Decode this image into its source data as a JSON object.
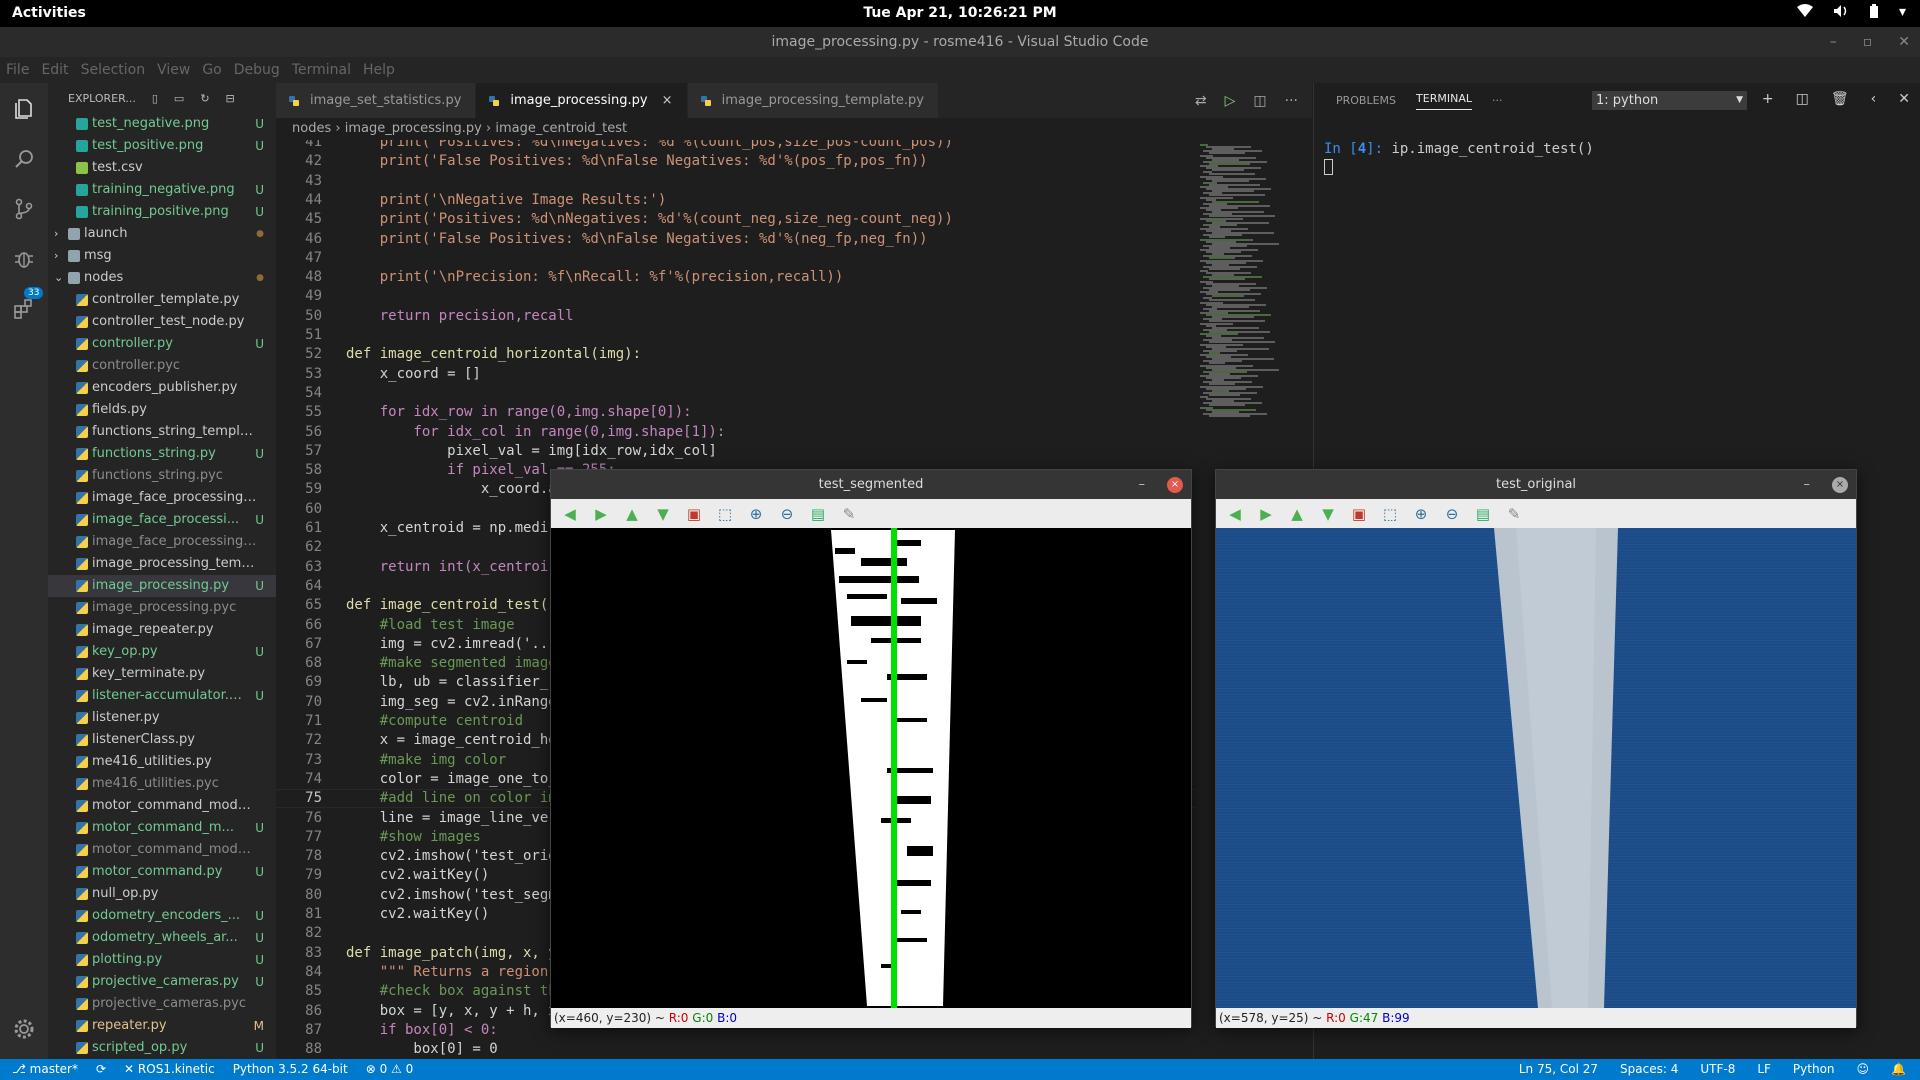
{
  "topbar": {
    "activities": "Activities",
    "clock": "Tue Apr 21, 10:26:21 PM"
  },
  "window": {
    "title": "image_processing.py - rosme416 - Visual Studio Code"
  },
  "menu": [
    "File",
    "Edit",
    "Selection",
    "View",
    "Go",
    "Debug",
    "Terminal",
    "Help"
  ],
  "activity": {
    "scm_badge": "33"
  },
  "explorer": {
    "title": "EXPLORER...",
    "files": [
      {
        "name": "test_negative.png",
        "status": "U",
        "color": "#73c991",
        "indent": 1,
        "icon": "image"
      },
      {
        "name": "test_positive.png",
        "status": "U",
        "color": "#73c991",
        "indent": 1,
        "icon": "image"
      },
      {
        "name": "test.csv",
        "status": "",
        "color": "#cccccc",
        "indent": 1,
        "icon": "csv"
      },
      {
        "name": "training_negative.png",
        "status": "U",
        "color": "#73c991",
        "indent": 1,
        "icon": "image"
      },
      {
        "name": "training_positive.png",
        "status": "U",
        "color": "#73c991",
        "indent": 1,
        "icon": "image"
      },
      {
        "name": "launch",
        "status": "●",
        "color": "#cccccc",
        "indent": 0,
        "icon": "folder",
        "arrow": ">"
      },
      {
        "name": "msg",
        "status": "",
        "color": "#cccccc",
        "indent": 0,
        "icon": "folder",
        "arrow": ">"
      },
      {
        "name": "nodes",
        "status": "●",
        "color": "#cccccc",
        "indent": 0,
        "icon": "folder",
        "arrow": "v"
      },
      {
        "name": "controller_template.py",
        "status": "",
        "color": "#cccccc",
        "indent": 1,
        "icon": "py"
      },
      {
        "name": "controller_test_node.py",
        "status": "",
        "color": "#cccccc",
        "indent": 1,
        "icon": "py"
      },
      {
        "name": "controller.py",
        "status": "U",
        "color": "#73c991",
        "indent": 1,
        "icon": "py"
      },
      {
        "name": "controller.pyc",
        "status": "",
        "color": "#8c8c8c",
        "indent": 1,
        "icon": "py"
      },
      {
        "name": "encoders_publisher.py",
        "status": "",
        "color": "#cccccc",
        "indent": 1,
        "icon": "py"
      },
      {
        "name": "fields.py",
        "status": "",
        "color": "#cccccc",
        "indent": 1,
        "icon": "py"
      },
      {
        "name": "functions_string_templat...",
        "status": "",
        "color": "#cccccc",
        "indent": 1,
        "icon": "py"
      },
      {
        "name": "functions_string.py",
        "status": "U",
        "color": "#73c991",
        "indent": 1,
        "icon": "py"
      },
      {
        "name": "functions_string.pyc",
        "status": "",
        "color": "#8c8c8c",
        "indent": 1,
        "icon": "py"
      },
      {
        "name": "image_face_processing_t...",
        "status": "",
        "color": "#cccccc",
        "indent": 1,
        "icon": "py"
      },
      {
        "name": "image_face_processi...",
        "status": "U",
        "color": "#73c991",
        "indent": 1,
        "icon": "py"
      },
      {
        "name": "image_face_processing.pyc",
        "status": "",
        "color": "#8c8c8c",
        "indent": 1,
        "icon": "py"
      },
      {
        "name": "image_processing_templ...",
        "status": "",
        "color": "#cccccc",
        "indent": 1,
        "icon": "py"
      },
      {
        "name": "image_processing.py",
        "status": "U",
        "color": "#73c991",
        "indent": 1,
        "icon": "py",
        "selected": true
      },
      {
        "name": "image_processing.pyc",
        "status": "",
        "color": "#8c8c8c",
        "indent": 1,
        "icon": "py"
      },
      {
        "name": "image_repeater.py",
        "status": "",
        "color": "#cccccc",
        "indent": 1,
        "icon": "py"
      },
      {
        "name": "key_op.py",
        "status": "U",
        "color": "#73c991",
        "indent": 1,
        "icon": "py"
      },
      {
        "name": "key_terminate.py",
        "status": "",
        "color": "#cccccc",
        "indent": 1,
        "icon": "py"
      },
      {
        "name": "listener-accumulator.py",
        "status": "U",
        "color": "#73c991",
        "indent": 1,
        "icon": "py"
      },
      {
        "name": "listener.py",
        "status": "",
        "color": "#cccccc",
        "indent": 1,
        "icon": "py"
      },
      {
        "name": "listenerClass.py",
        "status": "",
        "color": "#cccccc",
        "indent": 1,
        "icon": "py"
      },
      {
        "name": "me416_utilities.py",
        "status": "",
        "color": "#cccccc",
        "indent": 1,
        "icon": "py"
      },
      {
        "name": "me416_utilities.pyc",
        "status": "",
        "color": "#8c8c8c",
        "indent": 1,
        "icon": "py"
      },
      {
        "name": "motor_command_model_...",
        "status": "",
        "color": "#cccccc",
        "indent": 1,
        "icon": "py"
      },
      {
        "name": "motor_command_m...",
        "status": "U",
        "color": "#73c991",
        "indent": 1,
        "icon": "py"
      },
      {
        "name": "motor_command_model....",
        "status": "",
        "color": "#8c8c8c",
        "indent": 1,
        "icon": "py"
      },
      {
        "name": "motor_command.py",
        "status": "U",
        "color": "#73c991",
        "indent": 1,
        "icon": "py"
      },
      {
        "name": "null_op.py",
        "status": "",
        "color": "#cccccc",
        "indent": 1,
        "icon": "py"
      },
      {
        "name": "odometry_encoders_...",
        "status": "U",
        "color": "#73c991",
        "indent": 1,
        "icon": "py"
      },
      {
        "name": "odometry_wheels_ar...",
        "status": "U",
        "color": "#73c991",
        "indent": 1,
        "icon": "py"
      },
      {
        "name": "plotting.py",
        "status": "U",
        "color": "#73c991",
        "indent": 1,
        "icon": "py"
      },
      {
        "name": "projective_cameras.py",
        "status": "U",
        "color": "#73c991",
        "indent": 1,
        "icon": "py"
      },
      {
        "name": "projective_cameras.pyc",
        "status": "",
        "color": "#8c8c8c",
        "indent": 1,
        "icon": "py"
      },
      {
        "name": "repeater.py",
        "status": "M",
        "color": "#e2c08d",
        "indent": 1,
        "icon": "py"
      },
      {
        "name": "scripted_op.py",
        "status": "U",
        "color": "#73c991",
        "indent": 1,
        "icon": "py"
      }
    ]
  },
  "tabs": [
    {
      "label": "image_set_statistics.py",
      "active": false
    },
    {
      "label": "image_processing.py",
      "active": true,
      "close": "×"
    },
    {
      "label": "image_processing_template.py",
      "active": false
    }
  ],
  "breadcrumb": {
    "folder": "nodes",
    "sep": "›",
    "file": "image_processing.py",
    "symbol": "image_centroid_test"
  },
  "code": {
    "current_line": 75,
    "lines": [
      {
        "n": 41,
        "t": "    print('Positives: %d\\nNegatives: %d'%(count_pos,size_pos-count_pos))"
      },
      {
        "n": 42,
        "t": "    print('False Positives: %d\\nFalse Negatives: %d'%(pos_fp,pos_fn))"
      },
      {
        "n": 43,
        "t": ""
      },
      {
        "n": 44,
        "t": "    print('\\nNegative Image Results:')"
      },
      {
        "n": 45,
        "t": "    print('Positives: %d\\nNegatives: %d'%(count_neg,size_neg-count_neg))"
      },
      {
        "n": 46,
        "t": "    print('False Positives: %d\\nFalse Negatives: %d'%(neg_fp,neg_fn))"
      },
      {
        "n": 47,
        "t": ""
      },
      {
        "n": 48,
        "t": "    print('\\nPrecision: %f\\nRecall: %f'%(precision,recall))"
      },
      {
        "n": 49,
        "t": ""
      },
      {
        "n": 50,
        "t": "    return precision,recall"
      },
      {
        "n": 51,
        "t": ""
      },
      {
        "n": 52,
        "t": "def image_centroid_horizontal(img):"
      },
      {
        "n": 53,
        "t": "    x_coord = []"
      },
      {
        "n": 54,
        "t": ""
      },
      {
        "n": 55,
        "t": "    for idx_row in range(0,img.shape[0]):"
      },
      {
        "n": 56,
        "t": "        for idx_col in range(0,img.shape[1]):"
      },
      {
        "n": 57,
        "t": "            pixel_val = img[idx_row,idx_col]"
      },
      {
        "n": 58,
        "t": "            if pixel_val == 255:"
      },
      {
        "n": 59,
        "t": "                x_coord.a"
      },
      {
        "n": 60,
        "t": ""
      },
      {
        "n": 61,
        "t": "    x_centroid = np.medi"
      },
      {
        "n": 62,
        "t": ""
      },
      {
        "n": 63,
        "t": "    return int(x_centroi"
      },
      {
        "n": 64,
        "t": ""
      },
      {
        "n": 65,
        "t": "def image_centroid_test("
      },
      {
        "n": 66,
        "t": "    #load test image"
      },
      {
        "n": 67,
        "t": "    img = cv2.imread('..."
      },
      {
        "n": 68,
        "t": "    #make segmented image"
      },
      {
        "n": 69,
        "t": "    lb, ub = classifier_"
      },
      {
        "n": 70,
        "t": "    img_seg = cv2.inRange"
      },
      {
        "n": 71,
        "t": "    #compute centroid"
      },
      {
        "n": 72,
        "t": "    x = image_centroid_ho"
      },
      {
        "n": 73,
        "t": "    #make img color"
      },
      {
        "n": 74,
        "t": "    color = image_one_to_"
      },
      {
        "n": 75,
        "t": "    #add line on color im"
      },
      {
        "n": 76,
        "t": "    line = image_line_ver"
      },
      {
        "n": 77,
        "t": "    #show images"
      },
      {
        "n": 78,
        "t": "    cv2.imshow('test_orig"
      },
      {
        "n": 79,
        "t": "    cv2.waitKey()"
      },
      {
        "n": 80,
        "t": "    cv2.imshow('test_segm"
      },
      {
        "n": 81,
        "t": "    cv2.waitKey()"
      },
      {
        "n": 82,
        "t": ""
      },
      {
        "n": 83,
        "t": "def image_patch(img, x, y"
      },
      {
        "n": 84,
        "t": "    \"\"\" Returns a region"
      },
      {
        "n": 85,
        "t": "    #check box against th"
      },
      {
        "n": 86,
        "t": "    box = [y, x, y + h, x"
      },
      {
        "n": 87,
        "t": "    if box[0] < 0:"
      },
      {
        "n": 88,
        "t": "        box[0] = 0"
      },
      {
        "n": 89,
        "t": "    if box[1] < 0:"
      }
    ]
  },
  "panel": {
    "problems": "PROBLEMS",
    "terminal": "TERMINAL",
    "more": "···",
    "select": "1: python",
    "prompt_in": "In [",
    "prompt_num": "4",
    "prompt_close": "]:",
    "command": "ip.image_centroid_test()"
  },
  "win_seg": {
    "title": "test_segmented",
    "min": "–",
    "close": "×",
    "status_pos": "(x=460, y=230) ~ ",
    "r": "R:0",
    "g": "G:0",
    "b": "B:0"
  },
  "win_orig": {
    "title": "test_original",
    "min": "–",
    "close": "×",
    "status_pos": "(x=578, y=25) ~ ",
    "r": "R:0",
    "g": "G:47",
    "b": "B:99"
  },
  "status": {
    "branch": "master*",
    "sync": "⟳",
    "remote": "ROS1.kinetic",
    "python": "Python 3.5.2 64-bit",
    "errors": "⊗ 0",
    "warnings": "⚠ 0",
    "position": "Ln 75, Col 27",
    "spaces": "Spaces: 4",
    "encoding": "UTF-8",
    "eol": "LF",
    "language": "Python"
  },
  "colors": {
    "accent": "#007acc",
    "untracked": "#73c991",
    "modified": "#e2c08d",
    "keyword": "#569cd6",
    "string": "#ce9178",
    "comment": "#6a9955",
    "function": "#dcdcaa",
    "number": "#b5cea8"
  }
}
